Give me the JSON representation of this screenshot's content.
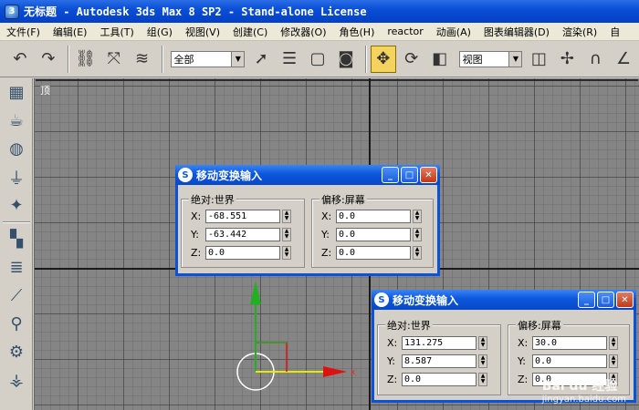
{
  "window": {
    "title": "无标题 - Autodesk 3ds Max 8 SP2  - Stand-alone License"
  },
  "menu": [
    "文件(F)",
    "编辑(E)",
    "工具(T)",
    "组(G)",
    "视图(V)",
    "创建(C)",
    "修改器(O)",
    "角色(H)",
    "reactor",
    "动画(A)",
    "图表编辑器(D)",
    "渲染(R)",
    "自"
  ],
  "toolbar": {
    "selection_filter": "全部",
    "coord_system": "视图"
  },
  "viewport": {
    "label": "顶"
  },
  "dialog1": {
    "title": "移动变换输入",
    "absolute_label": "绝对:世界",
    "offset_label": "偏移:屏幕",
    "abs": {
      "x": "-68.551",
      "y": "-63.442",
      "z": "0.0"
    },
    "off": {
      "x": "0.0",
      "y": "0.0",
      "z": "0.0"
    }
  },
  "dialog2": {
    "title": "移动变换输入",
    "absolute_label": "绝对:世界",
    "offset_label": "偏移:屏幕",
    "abs": {
      "x": "131.275",
      "y": "8.587",
      "z": "0.0"
    },
    "off": {
      "x": "30.0",
      "y": "0.0",
      "z": "0.0"
    }
  },
  "axis_labels": {
    "x": "x"
  },
  "watermark": {
    "brand": "Bai du 经验",
    "url": "jingyan.baidu.com"
  },
  "colors": {
    "title_blue": "#0a52d9",
    "viewport_bg": "#858585",
    "axis_y_green": "#22b022",
    "axis_x_red": "#dd1111",
    "gizmo_yellow": "#e8e800"
  }
}
